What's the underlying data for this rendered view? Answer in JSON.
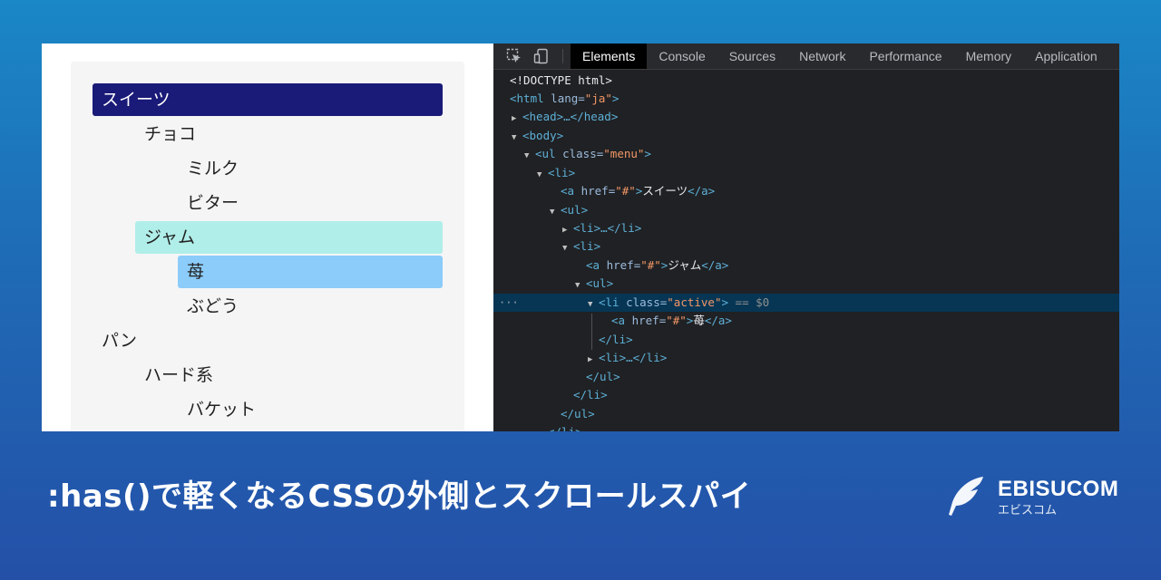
{
  "menu": {
    "items": [
      {
        "label": "スイーツ",
        "level": 0,
        "highlight": "navy"
      },
      {
        "label": "チョコ",
        "level": 1,
        "highlight": "none"
      },
      {
        "label": "ミルク",
        "level": 2,
        "highlight": "none"
      },
      {
        "label": "ビター",
        "level": 2,
        "highlight": "none"
      },
      {
        "label": "ジャム",
        "level": 1,
        "highlight": "teal"
      },
      {
        "label": "苺",
        "level": 2,
        "highlight": "blue"
      },
      {
        "label": "ぶどう",
        "level": 2,
        "highlight": "none"
      },
      {
        "label": "パン",
        "level": 0,
        "highlight": "none"
      },
      {
        "label": "ハード系",
        "level": 1,
        "highlight": "none"
      },
      {
        "label": "バケット",
        "level": 2,
        "highlight": "none"
      }
    ]
  },
  "devtools": {
    "tools": [
      "inspect-icon",
      "device-toolbar-icon"
    ],
    "tabs": [
      "Elements",
      "Console",
      "Sources",
      "Network",
      "Performance",
      "Memory",
      "Application"
    ],
    "active_tab": "Elements",
    "code": {
      "doctype": "<!DOCTYPE html>",
      "html_open": "<html",
      "lang_attr": " lang=",
      "lang_val": "\"ja\"",
      "gt": ">",
      "head": "<head>…</head>",
      "body_open": "<body>",
      "ul_open": "<ul",
      "class_attr": " class=",
      "menu_val": "\"menu\"",
      "li_open": "<li>",
      "a_open": "<a",
      "href_attr": " href=",
      "href_val": "\"#\"",
      "a_close": "</a>",
      "text_sweets": "スイーツ",
      "ul_plain": "<ul>",
      "li_collapsed": "<li>…</li>",
      "text_jam": "ジャム",
      "li_class_open": "<li",
      "active_val": "\"active\"",
      "selected_marker": " == $0",
      "text_strawberry": "苺",
      "li_close": "</li>",
      "ul_close": "</ul>",
      "ellipsis": "···"
    }
  },
  "page_title": ":has()で軽くなるCSSの外側とスクロールスパイ",
  "brand": {
    "name": "EBISUCOM",
    "sub": "エビスコム"
  },
  "colors": {
    "navy": "#1a1a78",
    "teal": "#b0eee9",
    "blue": "#8cccfa",
    "devtools_bg": "#202124",
    "selected_row": "#073655"
  }
}
